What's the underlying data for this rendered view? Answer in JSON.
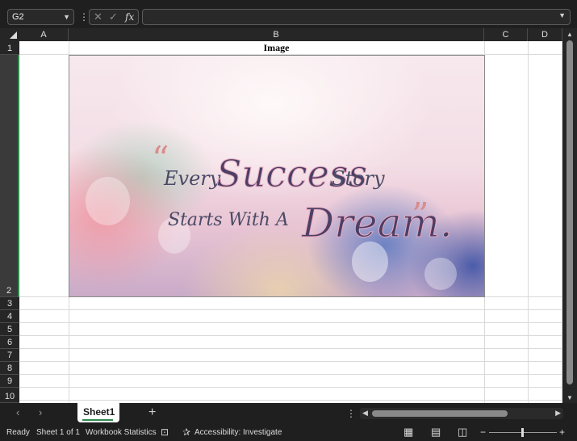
{
  "formula_bar": {
    "name_box": "G2",
    "name_box_dropdown_icon": "chevron-down-icon",
    "more_icon": "kebab-icon",
    "cancel_icon": "close-icon",
    "enter_icon": "checkmark-icon",
    "function_label": "fx",
    "formula_value": ""
  },
  "columns": [
    "A",
    "B",
    "C",
    "D"
  ],
  "rows": [
    "1",
    "2",
    "3",
    "4",
    "5",
    "6",
    "7",
    "8",
    "9",
    "10"
  ],
  "cells": {
    "B1": "Image"
  },
  "image": {
    "quote_open": "“",
    "line1_word1": "Every",
    "line1_word2": "Success",
    "line1_word3": "Story",
    "line2_word1": "Starts With A",
    "line2_word2": "Dream.",
    "quote_close": "”"
  },
  "sheet_tabs": {
    "prev_icon": "chevron-left-icon",
    "next_icon": "chevron-right-icon",
    "tabs": [
      "Sheet1"
    ],
    "active_tab": "Sheet1",
    "add_icon": "plus-icon"
  },
  "status_bar": {
    "ready": "Ready",
    "sheet_position": "Sheet 1 of 1",
    "workbook_statistics": "Workbook Statistics",
    "accessibility": "Accessibility: Investigate",
    "zoom_out": "−",
    "zoom_in": "+"
  },
  "colors": {
    "chrome_bg": "#1f1f1f",
    "selected_tab_accent": "#2d8b4e",
    "grid_line": "#dadada"
  }
}
